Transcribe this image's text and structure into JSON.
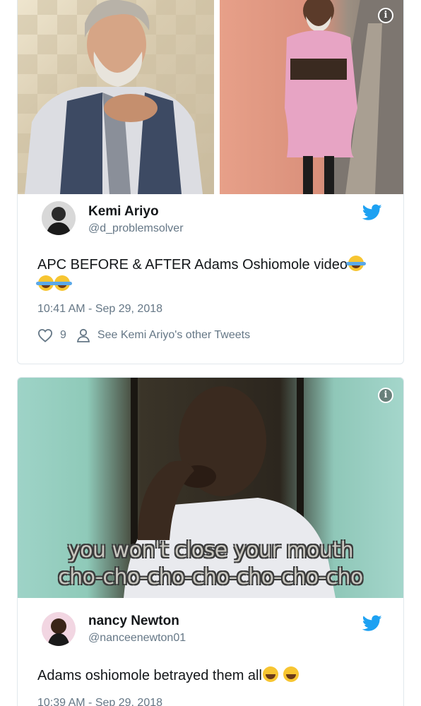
{
  "tweets": [
    {
      "author_name": "Kemi Ariyo",
      "author_handle": "@d_problemsolver",
      "text": "APC BEFORE & AFTER Adams Oshiomole video",
      "emoji_count": 3,
      "timestamp": "10:41 AM - Sep 29, 2018",
      "likes": "9",
      "profile_link": "See Kemi Ariyo's other Tweets"
    },
    {
      "author_name": "nancy Newton",
      "author_handle": "@nanceenewton01",
      "caption_line1": "you won't close your mouth",
      "caption_line2": "cho-cho-cho-cho-cho-cho-cho",
      "text": "Adams oshiomole betrayed them all",
      "emoji_count": 2,
      "timestamp": "10:39 AM - Sep 29, 2018"
    }
  ],
  "icons": {
    "info": "info-icon",
    "bird": "twitter-bird-icon",
    "like": "heart-icon",
    "profile": "person-icon"
  },
  "colors": {
    "twitter_blue": "#1da1f2",
    "secondary_text": "#657786",
    "border": "#e1e8ed"
  }
}
